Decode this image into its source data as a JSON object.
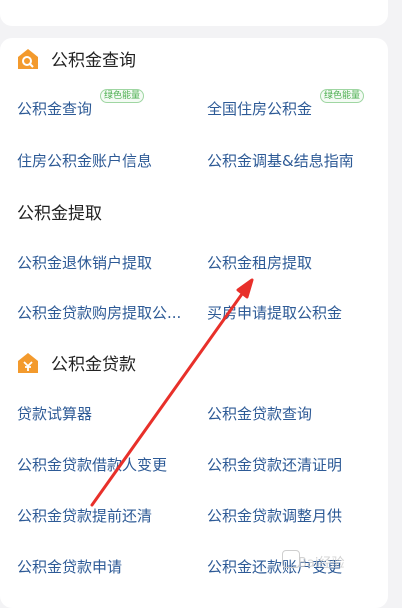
{
  "sections": [
    {
      "title": "公积金查询",
      "icon": "house-search-icon",
      "items": [
        {
          "label": "公积金查询",
          "badge": "绿色能量"
        },
        {
          "label": "全国住房公积金",
          "badge": "绿色能量"
        },
        {
          "label": "住房公积金账户信息"
        },
        {
          "label": "公积金调基&结息指南"
        }
      ]
    },
    {
      "title": "公积金提取",
      "items": [
        {
          "label": "公积金退休销户提取"
        },
        {
          "label": "公积金租房提取"
        },
        {
          "label": "公积金贷款购房提取公..."
        },
        {
          "label": "买房申请提取公积金"
        }
      ]
    },
    {
      "title": "公积金贷款",
      "icon": "house-loan-icon",
      "items": [
        {
          "label": "贷款试算器"
        },
        {
          "label": "公积金贷款查询"
        },
        {
          "label": "公积金贷款借款人变更"
        },
        {
          "label": "公积金贷款还清证明"
        },
        {
          "label": "公积金贷款提前还清"
        },
        {
          "label": "公积金贷款调整月供"
        },
        {
          "label": "公积金贷款申请"
        },
        {
          "label": "公积金还款账户变更"
        }
      ]
    }
  ],
  "watermark": "Bai经验",
  "colors": {
    "accent": "#f39a2d",
    "link": "#2d5a96",
    "arrow": "#e8302a"
  }
}
